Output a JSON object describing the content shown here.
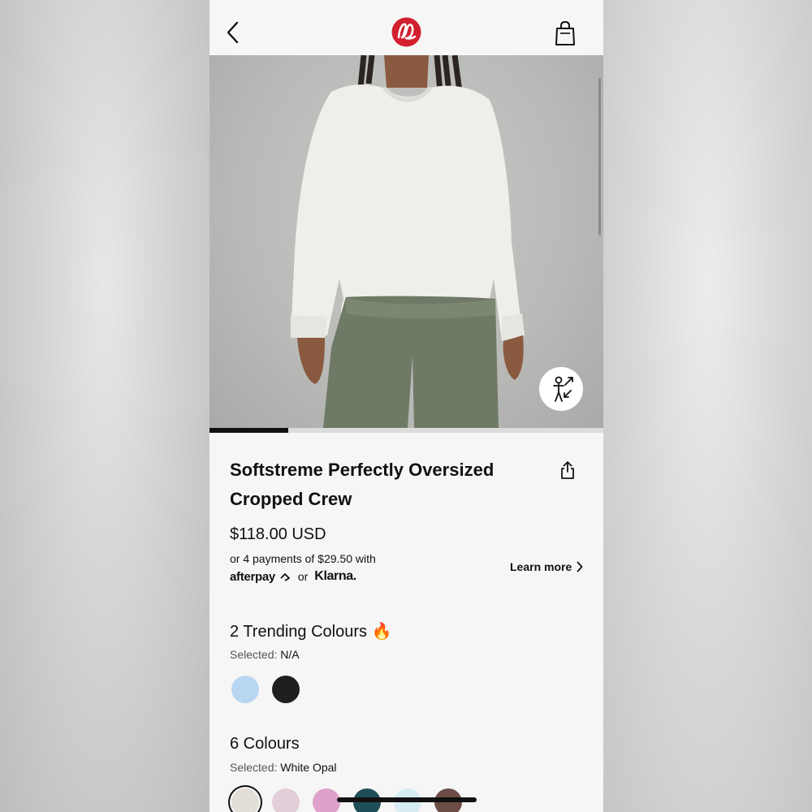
{
  "header": {
    "back_icon": "chevron-left-icon",
    "logo": "lululemon-logo",
    "bag_icon": "shopping-bag-icon"
  },
  "gallery": {
    "image_index": 1,
    "image_count": 5,
    "fit_icon": "body-fit-icon"
  },
  "product": {
    "title": "Softstreme Perfectly Oversized Cropped Crew",
    "price": "$118.00 USD",
    "installments": "or 4 payments of $29.50 with",
    "afterpay": "afterpay",
    "or": "or",
    "klarna": "Klarna.",
    "learn_more": "Learn more"
  },
  "trending": {
    "heading": "2 Trending Colours 🔥",
    "selected_label": "Selected:",
    "selected_value": "N/A",
    "swatches": [
      "#b9d6f3",
      "#1f1f1f"
    ]
  },
  "colours": {
    "heading": "6 Colours",
    "selected_label": "Selected:",
    "selected_value": "White Opal",
    "swatches": [
      "#e2ded7",
      "#e3cdd8",
      "#dea1cb",
      "#1e4e57",
      "#d8ecf3",
      "#6b4d45"
    ]
  },
  "colors": {
    "accent_red": "#d2202f",
    "background": "#f6f6f6",
    "text": "#111111"
  }
}
